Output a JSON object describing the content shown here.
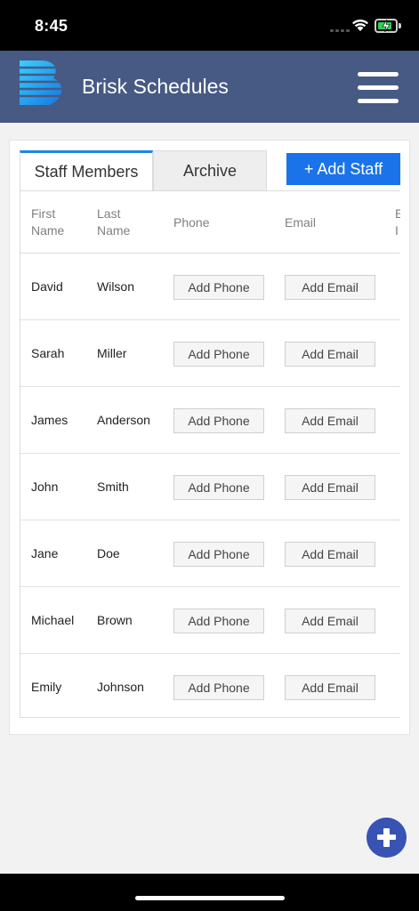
{
  "status": {
    "time": "8:45",
    "icons": [
      "signal-icon",
      "wifi-icon",
      "battery-charging-icon"
    ],
    "battery_color": "#30d158"
  },
  "header": {
    "title": "Brisk Schedules",
    "background": "#475a84",
    "logo_icon": "brisk-logo-icon",
    "menu_icon": "hamburger-menu-icon"
  },
  "tabs": [
    {
      "label": "Staff Members",
      "active": true
    },
    {
      "label": "Archive",
      "active": false
    }
  ],
  "add_staff_label": "+ Add Staff",
  "table": {
    "columns": [
      {
        "label": "First\nName"
      },
      {
        "label": "Last\nName"
      },
      {
        "label": "Phone"
      },
      {
        "label": "Email"
      },
      {
        "label": "E\nI"
      }
    ],
    "add_phone_label": "Add Phone",
    "add_email_label": "Add Email",
    "rows": [
      {
        "first": "David",
        "last": "Wilson"
      },
      {
        "first": "Sarah",
        "last": "Miller"
      },
      {
        "first": "James",
        "last": "Anderson"
      },
      {
        "first": "John",
        "last": "Smith"
      },
      {
        "first": "Jane",
        "last": "Doe"
      },
      {
        "first": "Michael",
        "last": "Brown"
      },
      {
        "first": "Emily",
        "last": "Johnson"
      }
    ]
  },
  "fab": {
    "icon": "plus-icon",
    "color": "#3853b3"
  },
  "accent_color": "#1a73e8"
}
